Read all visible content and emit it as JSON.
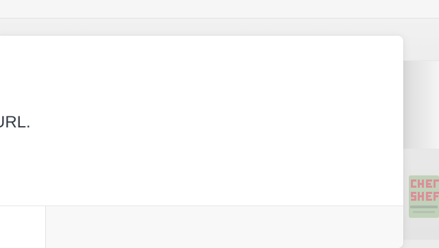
{
  "dialog": {
    "message": "URL."
  },
  "logo": {
    "colors": {
      "bg": "#bcd0b5",
      "text": "#e07a8c"
    }
  }
}
